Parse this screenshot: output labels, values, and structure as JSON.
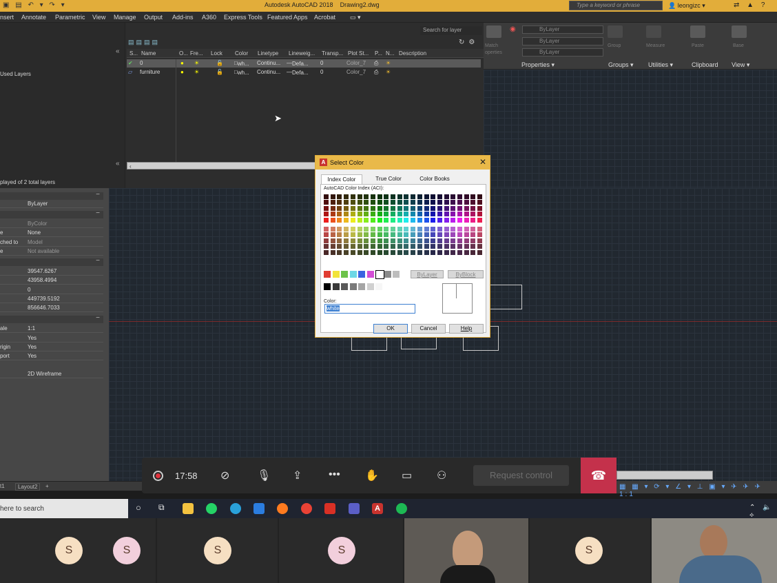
{
  "app": {
    "title": "Autodesk AutoCAD 2018",
    "document": "Drawing2.dwg",
    "search_placeholder": "Type a keyword or phrase",
    "user": "leongizc"
  },
  "menu": [
    "nsert",
    "Annotate",
    "Parametric",
    "View",
    "Manage",
    "Output",
    "Add-ins",
    "A360",
    "Express Tools",
    "Featured Apps",
    "Acrobat"
  ],
  "ribbon": {
    "groups": [
      "Properties",
      "Groups",
      "Utilities",
      "Clipboard",
      "View"
    ],
    "bylayer": "ByLayer",
    "labels": [
      "Match",
      "operties",
      "Group",
      "Measure",
      "Paste",
      "Base"
    ]
  },
  "layers": {
    "search_placeholder": "Search for layer",
    "filter_label": "Used Layers",
    "columns": [
      "S...",
      "Name",
      "O...",
      "Fre...",
      "Lock",
      "Color",
      "Linetype",
      "Lineweig...",
      "Transp...",
      "Plot St...",
      "P...",
      "N...",
      "Description"
    ],
    "rows": [
      {
        "name": "0",
        "color": "wh...",
        "linetype": "Continu...",
        "lineweight": "Defa...",
        "transparency": "0",
        "plot_style": "Color_7"
      },
      {
        "name": "furniture",
        "color": "wh...",
        "linetype": "Continu...",
        "lineweight": "Defa...",
        "transparency": "0",
        "plot_style": "Color_7"
      }
    ],
    "status": "played of 2 total layers"
  },
  "properties": {
    "rows": [
      {
        "k": "",
        "v": "ByLayer"
      },
      {
        "k": "",
        "v": "ByColor"
      },
      {
        "k": "e",
        "v": "None"
      },
      {
        "k": "ched to",
        "v": "Model"
      },
      {
        "k": "e",
        "v": "Not available"
      },
      {
        "k": "",
        "v": "39547.6267"
      },
      {
        "k": "",
        "v": "43958.4994"
      },
      {
        "k": "",
        "v": "0"
      },
      {
        "k": "",
        "v": "449739.5192"
      },
      {
        "k": "",
        "v": "856646.7033"
      },
      {
        "k": "ale",
        "v": "1:1"
      },
      {
        "k": "",
        "v": "Yes"
      },
      {
        "k": "rigin",
        "v": "Yes"
      },
      {
        "k": "port",
        "v": "Yes"
      },
      {
        "k": "",
        "v": "2D Wireframe"
      }
    ]
  },
  "tabs": [
    "t1",
    "Layout2",
    "+"
  ],
  "dialog": {
    "title": "Select Color",
    "tabs": [
      "Index Color",
      "True Color",
      "Color Books"
    ],
    "aci_label": "AutoCAD Color Index (ACI):",
    "bylayer": "ByLayer",
    "byblock": "ByBlock",
    "color_label": "Color:",
    "color_value": "white",
    "ok": "OK",
    "cancel": "Cancel",
    "help": "Help"
  },
  "taskbar": {
    "search": "here to search"
  },
  "meeting": {
    "timer": "17:58",
    "request_control": "Request control"
  },
  "participants": [
    "S",
    "S",
    "S",
    "S",
    "S"
  ]
}
